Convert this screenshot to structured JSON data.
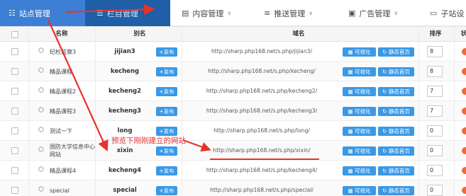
{
  "nav": {
    "items": [
      {
        "label": "站点管理",
        "icon": "sitemap-icon"
      },
      {
        "label": "栏目管理",
        "icon": "list-icon"
      },
      {
        "label": "内容管理",
        "icon": "document-icon"
      },
      {
        "label": "推送管理",
        "icon": "sliders-icon"
      },
      {
        "label": "广告管理",
        "icon": "megaphone-icon"
      },
      {
        "label": "子站设",
        "icon": "monitor-icon"
      }
    ]
  },
  "table": {
    "headers": {
      "name": "名称",
      "alias": "别名",
      "domain": "域名",
      "sort": "排序",
      "status": "状"
    },
    "publish_label": "+发布",
    "visual_label": "可视化",
    "static_label": "静态首页",
    "rows": [
      {
        "name": "纪检监察3",
        "alias": "jijian3",
        "url": "http://sharp.php168.net/s.php/jijian3/",
        "sort": "8"
      },
      {
        "name": "精品课程",
        "alias": "kecheng",
        "url": "http://sharp.php168.net/s.php/kecheng/",
        "sort": "8"
      },
      {
        "name": "精品课程2",
        "alias": "kecheng2",
        "url": "http://sharp.php168.net/s.php/kecheng2/",
        "sort": "7"
      },
      {
        "name": "精品课程3",
        "alias": "kecheng3",
        "url": "http://sharp.php168.net/s.php/kecheng3/",
        "sort": "7"
      },
      {
        "name": "测试一下",
        "alias": "long",
        "url": "http://sharp.php168.net/s.php/long/",
        "sort": "0"
      },
      {
        "name": "国防大学信息中心网站",
        "alias": "xixin",
        "url": "http://sharp.php168.net/s.php/xixin/",
        "sort": "0"
      },
      {
        "name": "精品课程4",
        "alias": "kecheng4",
        "url": "http://sharp.php168.net/s.php/kecheng4/",
        "sort": "0"
      },
      {
        "name": "special",
        "alias": "special",
        "url": "http://sharp.php168.net/s.php/special/",
        "sort": "0"
      }
    ]
  },
  "annotation": {
    "text": "预览下刚刚建立的网站",
    "color": "#e8322c"
  },
  "colors": {
    "accent": "#3d7fd4",
    "nav_dark": "#1e5fa8",
    "button": "#3a99e6",
    "status": "#ee6a3a"
  }
}
